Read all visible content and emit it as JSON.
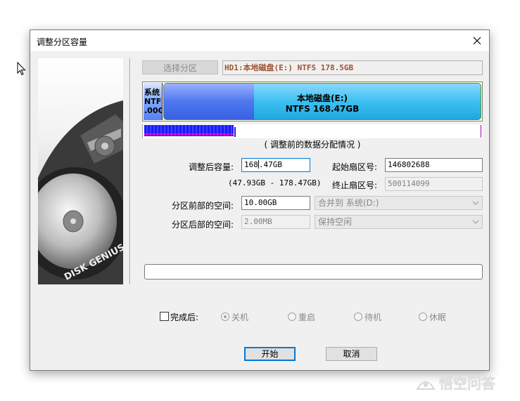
{
  "window": {
    "title": "调整分区容量",
    "close_glyph": "✕"
  },
  "art": {
    "brand": "DISK GENIUS"
  },
  "select_button": "选择分区",
  "disk_label": "HD1:本地磁盘(E:) NTFS 178.5GB",
  "disk_map": {
    "sys_partition": {
      "line1": "系统",
      "line2": "NTFS",
      "line3": ".00G"
    },
    "local_partition": {
      "line1": "本地磁盘(E:)",
      "line2": "NTFS 168.47GB"
    }
  },
  "usage": {
    "used_fraction": 0.27
  },
  "caption": "( 调整前的数据分配情况 )",
  "form": {
    "new_size_label": "调整后容量:",
    "new_size_value": "168.47GB",
    "new_size_before_caret": "168",
    "new_size_after_caret": ".47GB",
    "range_hint": "(47.93GB - 178.47GB)",
    "start_sector_label": "起始扇区号:",
    "start_sector_value": "146802688",
    "end_sector_label": "终止扇区号:",
    "end_sector_value": "500114099",
    "front_space_label": "分区前部的空间:",
    "front_space_value": "10.00GB",
    "front_space_action": "合并到 系统(D:)",
    "rear_space_label": "分区后部的空间:",
    "rear_space_value": "2.00MB",
    "rear_space_action": "保持空闲"
  },
  "after_complete": {
    "label": "完成后:",
    "options": [
      "关机",
      "重启",
      "待机",
      "休眠"
    ],
    "selected": "关机"
  },
  "buttons": {
    "start": "开始",
    "cancel": "取消"
  },
  "watermark": "悟空问答",
  "colors": {
    "disk_label": "#a0522d",
    "focus": "#0078d7",
    "partition_cyan": "#3ec0f0",
    "partition_blue": "#4f78ef"
  }
}
